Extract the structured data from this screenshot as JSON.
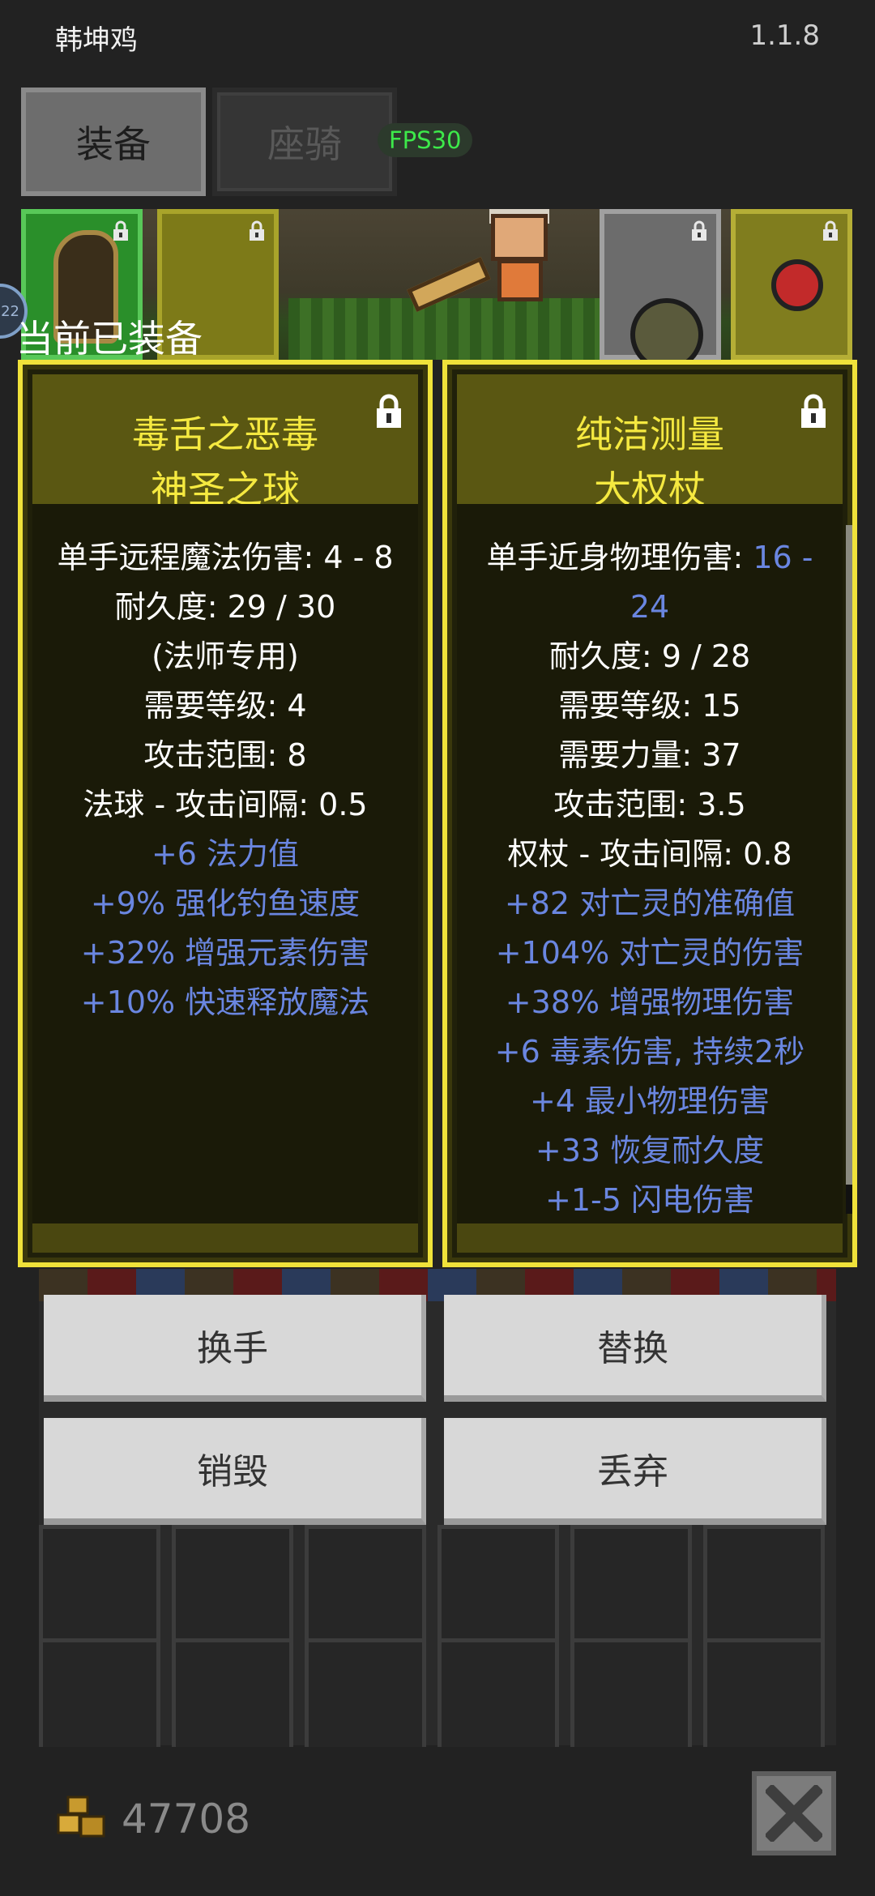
{
  "header": {
    "player_name": "韩坤鸡",
    "version": "1.1.8"
  },
  "tabs": [
    {
      "label": "装备",
      "active": true
    },
    {
      "label": "座骑",
      "active": false
    }
  ],
  "fps": "FPS30",
  "scene_badge": "22",
  "equipped_label": "当前已装备",
  "cards": [
    {
      "name_line1": "毒舌之恶毒",
      "name_line2": "神圣之球",
      "locked": true,
      "stats": [
        {
          "text": "单手远程魔法伤害: 4 - 8"
        },
        {
          "text": "耐久度: 29 / 30"
        },
        {
          "text": "(法师专用)"
        },
        {
          "text": "需要等级: 4"
        },
        {
          "text": "攻击范围: 8"
        },
        {
          "text": "法球 - 攻击间隔: 0.5"
        },
        {
          "text": "+6 法力值",
          "color": "blue"
        },
        {
          "text": "+9% 强化钓鱼速度",
          "color": "blue"
        },
        {
          "text": "+32% 增强元素伤害",
          "color": "blue"
        },
        {
          "text": "+10% 快速释放魔法",
          "color": "blue"
        }
      ]
    },
    {
      "name_line1": "纯洁测量",
      "name_line2": "大权杖",
      "locked": true,
      "damage_label": "单手近身物理伤害: ",
      "damage_value_part1": "16 -",
      "damage_value_part2": "24",
      "stats": [
        {
          "text": "耐久度: 9 / 28"
        },
        {
          "text": "需要等级: 15"
        },
        {
          "text": "需要力量: 37"
        },
        {
          "text": "攻击范围: 3.5"
        },
        {
          "text": "权杖 - 攻击间隔: 0.8"
        },
        {
          "text": "+82 对亡灵的准确值",
          "color": "blue"
        },
        {
          "text": "+104% 对亡灵的伤害",
          "color": "blue"
        },
        {
          "text": "+38% 增强物理伤害",
          "color": "blue"
        },
        {
          "text": "+6 毒素伤害, 持续2秒",
          "color": "blue"
        },
        {
          "text": "+4 最小物理伤害",
          "color": "blue"
        },
        {
          "text": "+33 恢复耐久度",
          "color": "blue"
        },
        {
          "text": "+1-5 闪电伤害",
          "color": "blue"
        }
      ]
    }
  ],
  "actions": {
    "swap_hand": "换手",
    "replace": "替换",
    "destroy": "销毁",
    "discard": "丢弃"
  },
  "footer": {
    "gold": "47708"
  },
  "colors": {
    "item_title": "#f5e940",
    "magic_stat": "#6a86e0",
    "card_border": "#f0e23a",
    "fps": "#3de94a"
  }
}
